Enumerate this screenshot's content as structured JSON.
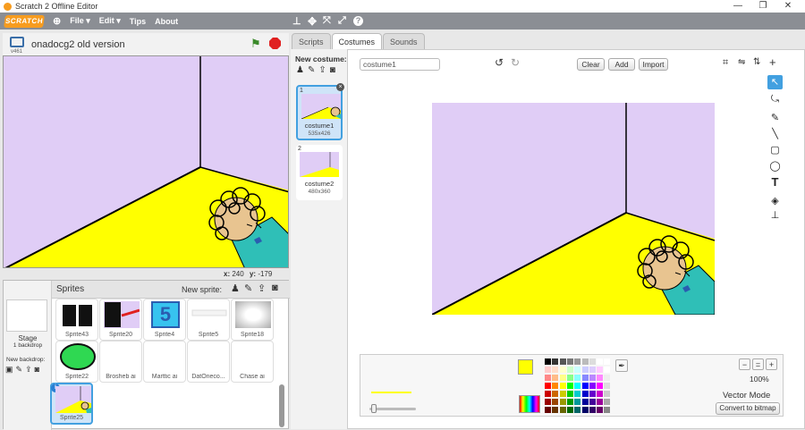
{
  "window": {
    "title": "Scratch 2 Offline Editor",
    "controls": [
      "—",
      "❐",
      "✕"
    ]
  },
  "menubar": {
    "logo": "SCRATCH",
    "items": [
      "File ▾",
      "Edit ▾",
      "Tips",
      "About"
    ]
  },
  "project": {
    "name": "onadocg2 old version",
    "version": "v461"
  },
  "stage_coords": {
    "x_label": "x:",
    "x": "240",
    "y_label": "y:",
    "y": "-179"
  },
  "sprites": {
    "header": "Sprites",
    "new_sprite": "New sprite:",
    "stage_label": "Stage",
    "stage_sub": "1 backdrop",
    "new_backdrop": "New backdrop:",
    "items": [
      {
        "name": "Sprite43"
      },
      {
        "name": "Sprite20"
      },
      {
        "name": "Sprite4",
        "badge": "5"
      },
      {
        "name": "Sprite5"
      },
      {
        "name": "Sprite18"
      },
      {
        "name": "Sprite22"
      },
      {
        "name": "Brosheb ai"
      },
      {
        "name": "Marttic ai"
      },
      {
        "name": "DatOneco..."
      },
      {
        "name": "Chase ai"
      },
      {
        "name": "Sprite25"
      }
    ]
  },
  "tabs": [
    "Scripts",
    "Costumes",
    "Sounds"
  ],
  "costumes": {
    "new_label": "New costume:",
    "items": [
      {
        "index": "1",
        "name": "costume1",
        "size": "535x426"
      },
      {
        "index": "2",
        "name": "costume2",
        "size": "480x360"
      }
    ]
  },
  "editor": {
    "name_value": "costume1",
    "clear": "Clear",
    "add": "Add",
    "import": "Import",
    "zoom": "100%",
    "mode": "Vector Mode",
    "convert": "Convert to bitmap",
    "fill_color": "#ffff00",
    "line_color": "#ffff00"
  },
  "colors": {
    "wall": "#e0cdf6",
    "floor": "#ffff00",
    "shirt": "#2fbfb7",
    "skin": "#e8c490",
    "accent": "#42a0e0"
  }
}
